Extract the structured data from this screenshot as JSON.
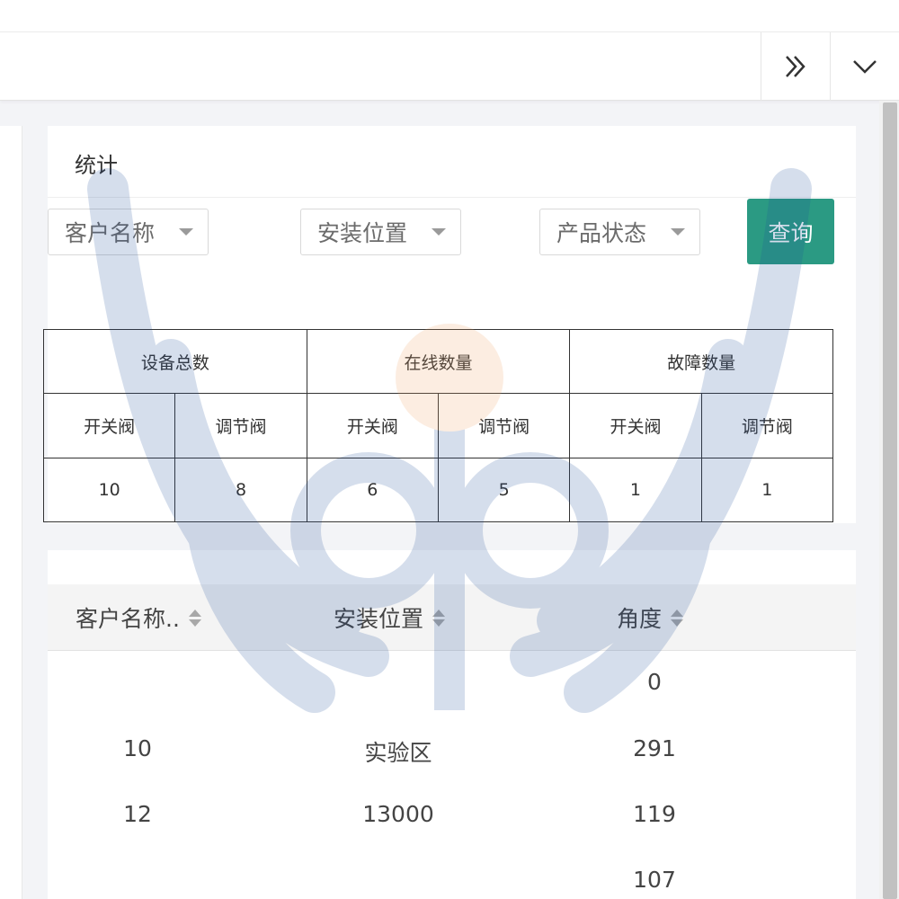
{
  "tabbar": {
    "more_icon": "double-chevron-right-icon",
    "dropdown_icon": "chevron-down-icon"
  },
  "stats": {
    "title": "统计",
    "filters": {
      "customer": "客户名称",
      "location": "安装位置",
      "status": "产品状态"
    },
    "query_label": "查询",
    "groups": {
      "total": "设备总数",
      "online": "在线数量",
      "fault": "故障数量"
    },
    "types": {
      "switch_valve": "开关阀",
      "regulating_valve": "调节阀"
    },
    "values": {
      "total_switch": "10",
      "total_regulating": "8",
      "online_switch": "6",
      "online_regulating": "5",
      "fault_switch": "1",
      "fault_regulating": "1"
    },
    "accent_color": "#2b9a83"
  },
  "list": {
    "columns": {
      "customer": "客户名称..",
      "location": "安装位置",
      "angle": "角度"
    },
    "rows": [
      {
        "customer": "",
        "location": "",
        "angle": "0"
      },
      {
        "customer": "10",
        "location": "实验区",
        "angle": "291"
      },
      {
        "customer": "12",
        "location": "13000",
        "angle": "119"
      },
      {
        "customer": "",
        "location": "",
        "angle": "107"
      }
    ]
  }
}
